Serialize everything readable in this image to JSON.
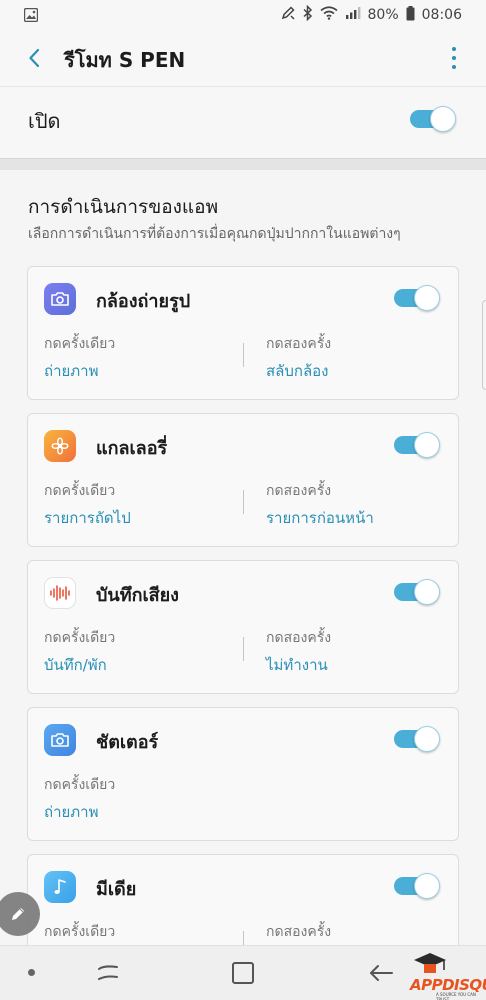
{
  "status_bar": {
    "battery": "80%",
    "time": "08:06"
  },
  "app_bar": {
    "title": "รีโมท S PEN",
    "back_icon": "chevron-left-icon",
    "more_icon": "more-vertical-icon"
  },
  "master_switch": {
    "label": "เปิด",
    "on": true
  },
  "section": {
    "title": "การดำเนินการของแอพ",
    "subtitle": "เลือกการดำเนินการที่ต้องการเมื่อคุณกดปุ่มปากกาในแอพต่างๆ"
  },
  "apps": [
    {
      "name": "กล้องถ่ายรูป",
      "icon": "camera-icon",
      "on": true,
      "single_label": "กดครั้งเดียว",
      "single_value": "ถ่ายภาพ",
      "double_label": "กดสองครั้ง",
      "double_value": "สลับกล้อง"
    },
    {
      "name": "แกลเลอรี่",
      "icon": "gallery-flower-icon",
      "on": true,
      "single_label": "กดครั้งเดียว",
      "single_value": "รายการถัดไป",
      "double_label": "กดสองครั้ง",
      "double_value": "รายการก่อนหน้า"
    },
    {
      "name": "บันทึกเสียง",
      "icon": "voice-recorder-icon",
      "on": true,
      "single_label": "กดครั้งเดียว",
      "single_value": "บันทึก/พัก",
      "double_label": "กดสองครั้ง",
      "double_value": "ไม่ทำงาน"
    },
    {
      "name": "ชัตเตอร์",
      "icon": "camera-icon",
      "on": true,
      "single_label": "กดครั้งเดียว",
      "single_value": "ถ่ายภาพ"
    },
    {
      "name": "มีเดีย",
      "icon": "music-note-icon",
      "on": true,
      "single_label": "กดครั้งเดียว",
      "double_label": "กดสองครั้ง"
    }
  ],
  "watermark": {
    "brand": "APPDISQUS",
    "tagline": "A SOURCE YOU CAN TRUST"
  },
  "colors": {
    "accent": "#2a8fb5",
    "toggle_on": "#4aaed6"
  }
}
